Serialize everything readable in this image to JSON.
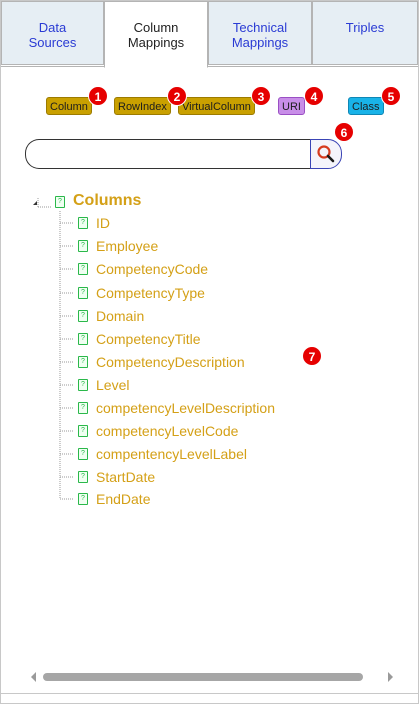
{
  "tabs": [
    {
      "line1": "Data",
      "line2": "Sources"
    },
    {
      "line1": "Column",
      "line2": "Mappings"
    },
    {
      "line1": "Technical",
      "line2": "Mappings"
    },
    {
      "line1": "Triples",
      "line2": ""
    }
  ],
  "active_tab": "Column Mappings",
  "chips": {
    "column": "Column",
    "rowindex": "RowIndex",
    "virtualcolumn": "VirtualColumn",
    "uri": "URI",
    "class": "Class"
  },
  "badges": [
    "1",
    "2",
    "3",
    "4",
    "5",
    "6",
    "7"
  ],
  "search": {
    "value": "",
    "placeholder": ""
  },
  "tree": {
    "root": "Columns",
    "items": [
      "ID",
      "Employee",
      "CompetencyCode",
      "CompetencyType",
      "Domain",
      "CompetencyTitle",
      "CompetencyDescription",
      "Level",
      "competencyLevelDescription",
      "competencyLevelCode",
      "compentencyLevelLabel",
      "StartDate",
      "EndDate"
    ]
  },
  "colors": {
    "tab_bg": "#e6eef4",
    "tab_text": "#2a3bd4",
    "tree_text": "#d4a017",
    "chip_gold": "#c9a000",
    "chip_purple": "#c88ee8",
    "chip_cyan": "#19b3e8",
    "badge": "#e60000",
    "node_icon": "#2ab84a"
  },
  "icons": {
    "search_button": "magnifier-icon",
    "tree_expander": "tree-collapse-icon",
    "node": "question-file-icon"
  }
}
